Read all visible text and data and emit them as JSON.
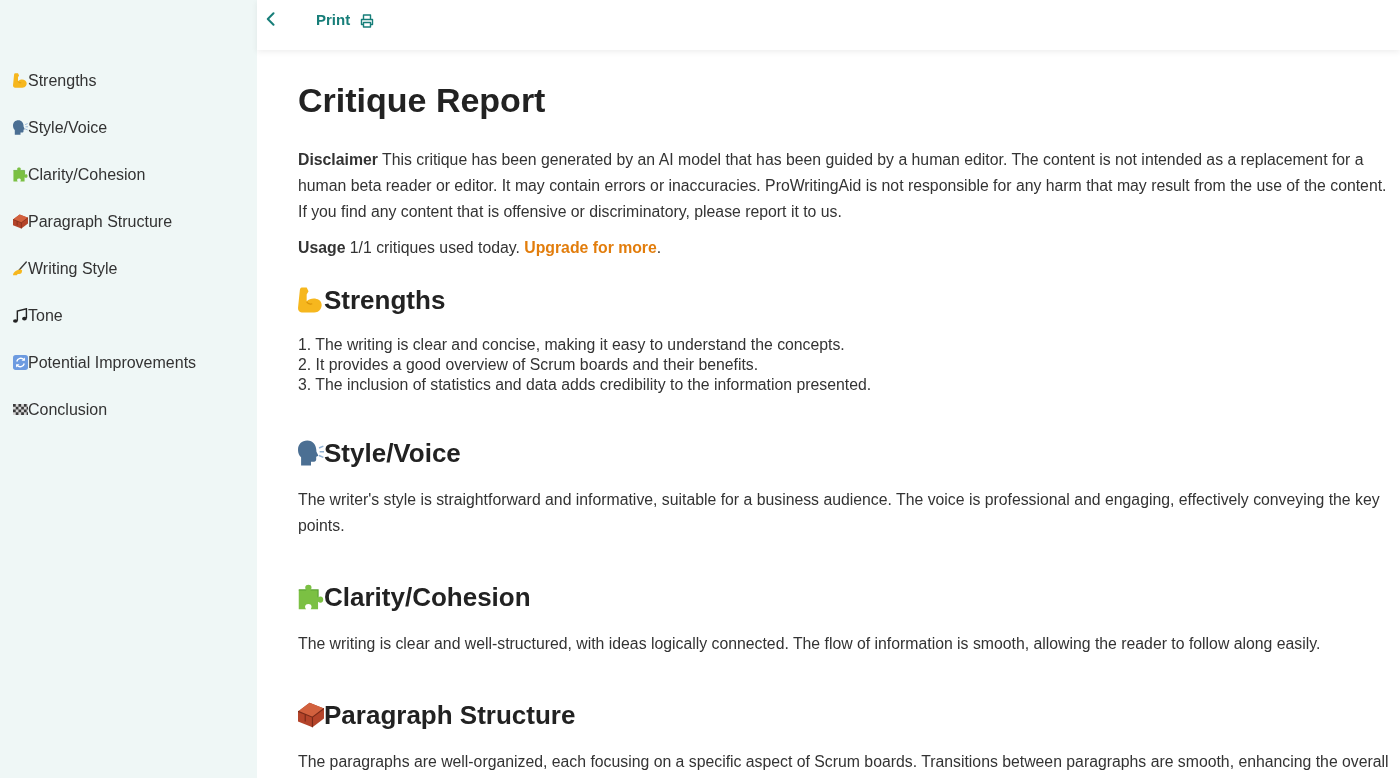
{
  "toolbar": {
    "print_label": "Print"
  },
  "sidebar": {
    "items": [
      {
        "label": "Strengths"
      },
      {
        "label": "Style/Voice"
      },
      {
        "label": "Clarity/Cohesion"
      },
      {
        "label": "Paragraph Structure"
      },
      {
        "label": "Writing Style"
      },
      {
        "label": "Tone"
      },
      {
        "label": "Potential Improvements"
      },
      {
        "label": "Conclusion"
      }
    ]
  },
  "report": {
    "title": "Critique Report",
    "disclaimer": "**Disclaimer** This critique has been generated by an AI model that has been guided by a human editor. The content is not intended as a replacement for a human beta reader or editor. It may contain errors or inaccuracies. ProWritingAid is not responsible for any harm that may result from the use of the content. If you find any content that is offensive or discriminatory, please report it to us.",
    "usage": {
      "text": "**Usage** 1/1 critiques used today.",
      "link": "Upgrade for more",
      "after": "."
    },
    "sections": [
      {
        "kind": "list",
        "heading": "Strengths",
        "items": [
          "1. The writing is clear and concise, making it easy to understand the concepts.",
          "2. It provides a good overview of Scrum boards and their benefits.",
          "3. The inclusion of statistics and data adds credibility to the information presented."
        ]
      },
      {
        "kind": "paragraph",
        "heading": "Style/Voice",
        "text": "The writer's style is straightforward and informative, suitable for a business audience. The voice is professional and engaging, effectively conveying the key points."
      },
      {
        "kind": "paragraph",
        "heading": "Clarity/Cohesion",
        "text": "The writing is clear and well-structured, with ideas logically connected. The flow of information is smooth, allowing the reader to follow along easily."
      },
      {
        "kind": "paragraph",
        "heading": "Paragraph Structure",
        "text": "The paragraphs are well-organized, each focusing on a specific aspect of Scrum boards. Transitions between paragraphs are smooth, enhancing the overall"
      }
    ]
  }
}
